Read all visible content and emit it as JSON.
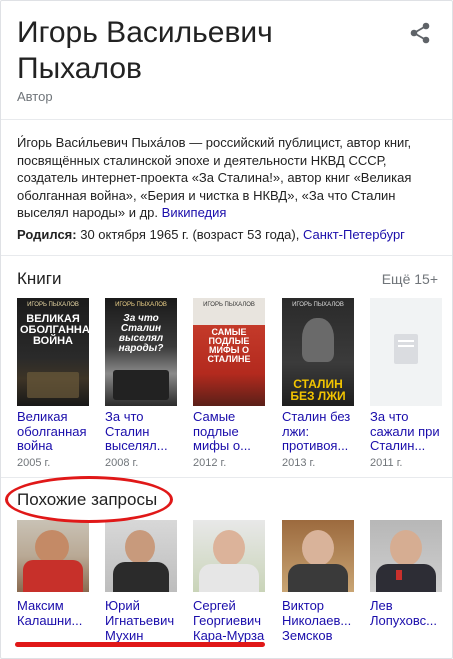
{
  "header": {
    "title": "Игорь Васильевич Пыхалов",
    "subtitle": "Автор",
    "share_icon": "share-icon"
  },
  "description": {
    "text": "И́горь Васи́льевич Пыха́лов — российский публицист, автор книг, посвящённых сталинской эпохе и деятельности НКВД СССР, создатель интернет-проекта «За Сталина!», автор книг «Великая оболганная война», «Берия и чистка в НКВД», «За что Сталин выселял народы» и др.",
    "source_link": "Википедия"
  },
  "born": {
    "label": "Родился:",
    "value": "30 октября 1965 г. (возраст 53 года),",
    "place_link": "Санкт-Петербург"
  },
  "books_section": {
    "title": "Книги",
    "more": "Ещё 15+",
    "items": [
      {
        "title": "Великая оболганная война",
        "year": "2005 г.",
        "cover_author": "ИГОРЬ ПЫХАЛОВ",
        "cover_title": "ВЕЛИКАЯ ОБОЛГАННАЯ ВОЙНА"
      },
      {
        "title": "За что Сталин выселял...",
        "year": "2008 г.",
        "cover_author": "ИГОРЬ ПЫХАЛОВ",
        "cover_title": "За что Сталин выселял народы?"
      },
      {
        "title": "Самые подлые мифы о...",
        "year": "2012 г.",
        "cover_author": "ИГОРЬ ПЫХАЛОВ",
        "cover_title": "САМЫЕ ПОДЛЫЕ МИФЫ О СТАЛИНЕ"
      },
      {
        "title": "Сталин без лжи: противоя...",
        "year": "2013 г.",
        "cover_author": "ИГОРЬ ПЫХАЛОВ",
        "cover_title": "СТАЛИН БЕЗ ЛЖИ"
      },
      {
        "title": "За что сажали при Сталин...",
        "year": "2011 г.",
        "cover_author": "",
        "cover_title": ""
      }
    ]
  },
  "related_section": {
    "title": "Похожие запросы",
    "items": [
      {
        "name": "Максим Калашни..."
      },
      {
        "name": "Юрий Игнатьевич Мухин"
      },
      {
        "name": "Сергей Георгиевич Кара-Мурза"
      },
      {
        "name": "Виктор Николаев... Земсков"
      },
      {
        "name": "Лев Лопуховс..."
      }
    ]
  },
  "colors": {
    "link": "#1a0dab",
    "muted": "#70757a",
    "annotation_red": "#e01818"
  }
}
